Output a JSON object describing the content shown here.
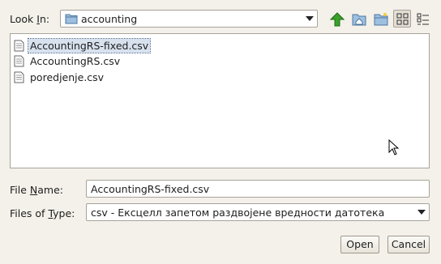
{
  "look_in": {
    "label_pre": "Look ",
    "label_mnemonic": "I",
    "label_post": "n:",
    "value": "accounting"
  },
  "toolbar": {
    "buttons": [
      {
        "icon": "up-folder-icon"
      },
      {
        "icon": "home-folder-icon"
      },
      {
        "icon": "new-folder-icon"
      },
      {
        "icon": "list-view-icon"
      },
      {
        "icon": "details-view-icon"
      }
    ]
  },
  "files": [
    {
      "name": "AccountingRS-fixed.csv",
      "selected": true
    },
    {
      "name": "AccountingRS.csv",
      "selected": false
    },
    {
      "name": "poredjenje.csv",
      "selected": false
    }
  ],
  "file_name": {
    "label_pre": "File ",
    "label_mnemonic": "N",
    "label_post": "ame:",
    "value": "AccountingRS-fixed.csv"
  },
  "files_of_type": {
    "label_pre": "Files of ",
    "label_mnemonic": "T",
    "label_post": "ype:",
    "value": "csv - Ексцелл запетом раздвојене вредности датотека"
  },
  "buttons": {
    "open": "Open",
    "cancel": "Cancel"
  },
  "colors": {
    "dialog_bg": "#f4f1ea",
    "selection": "#d8e2ee",
    "up_arrow": "#3aa02a",
    "folder": "#7ea6cc"
  }
}
